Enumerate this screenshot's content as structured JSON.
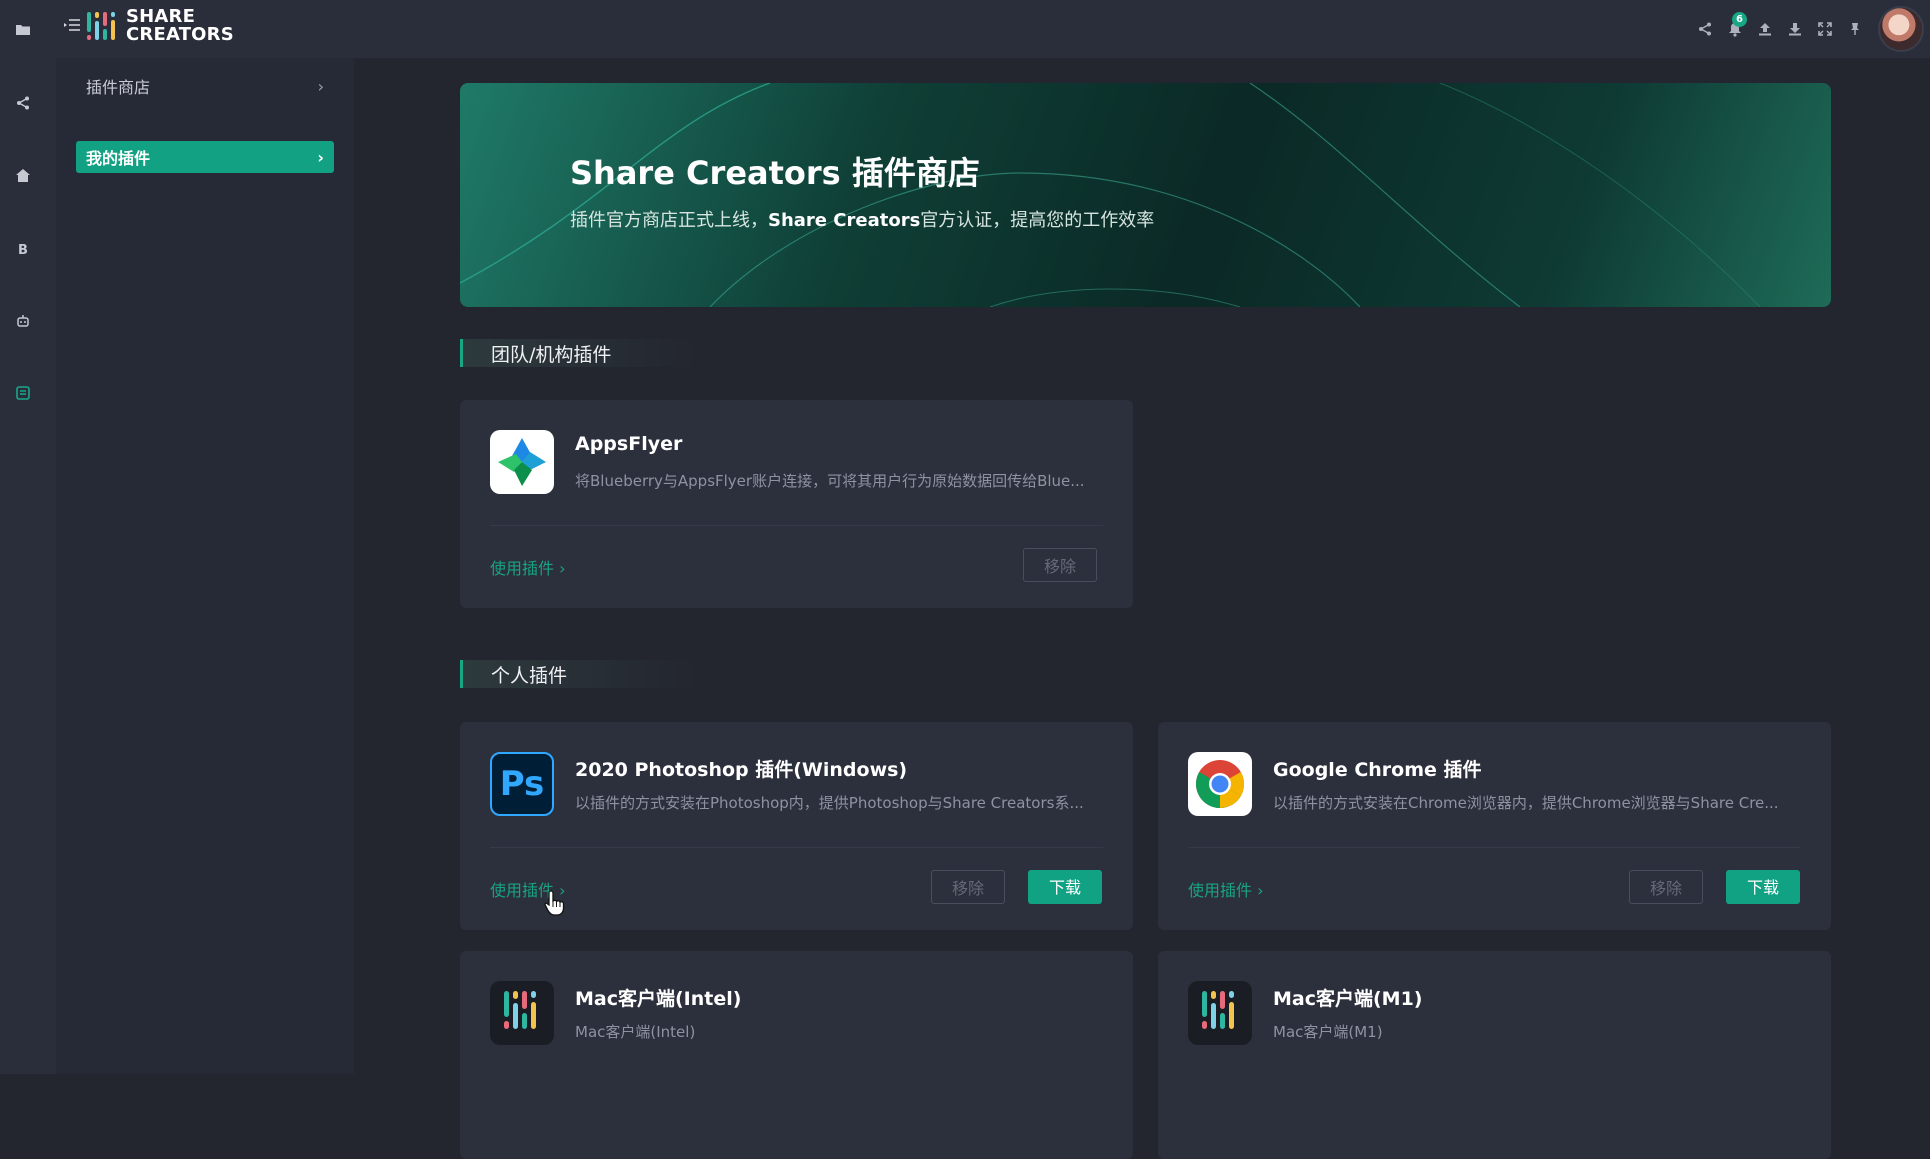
{
  "app": {
    "logo_line1": "SHARE",
    "logo_line2": "CREATORS",
    "notification_count": "6"
  },
  "sidebar": {
    "items": [
      {
        "label": "插件商店",
        "active": false
      },
      {
        "label": "我的插件",
        "active": true
      }
    ]
  },
  "hero": {
    "title": "Share Creators 插件商店",
    "subtitle_pre": "插件官方商店正式上线，",
    "subtitle_bold": "Share Creators",
    "subtitle_post": "官方认证，提高您的工作效率"
  },
  "sections": {
    "team": {
      "title": "团队/机构插件"
    },
    "personal": {
      "title": "个人插件"
    }
  },
  "cards": {
    "appsflyer": {
      "title": "AppsFlyer",
      "desc": "将Blueberry与AppsFlyer账户连接，可将其用户行为原始数据回传给Blue...",
      "link": "使用插件 ›",
      "remove": "移除"
    },
    "photoshop": {
      "title": "2020 Photoshop 插件(Windows)",
      "desc": "以插件的方式安装在Photoshop内，提供Photoshop与Share Creators系...",
      "link": "使用插件 ›",
      "remove": "移除",
      "download": "下载",
      "icon_text": "Ps"
    },
    "chrome": {
      "title": "Google Chrome 插件",
      "desc": "以插件的方式安装在Chrome浏览器内，提供Chrome浏览器与Share Cre...",
      "link": "使用插件 ›",
      "remove": "移除",
      "download": "下载"
    },
    "mac_intel": {
      "title": "Mac客户端(Intel)",
      "desc": "Mac客户端(Intel)"
    },
    "mac_m1": {
      "title": "Mac客户端(M1)",
      "desc": "Mac客户端(M1)"
    }
  },
  "icons": {
    "rail": [
      "folder-icon",
      "share-icon",
      "home-icon",
      "bitcoin-icon",
      "robot-icon",
      "plugin-store-icon"
    ],
    "top": [
      "share-icon",
      "bell-icon",
      "upload-icon",
      "download-icon",
      "fullscreen-icon",
      "pin-icon"
    ]
  },
  "colors": {
    "accent": "#12a183",
    "background": "#23252f",
    "card": "#2c2f3c",
    "sidebar": "#262936"
  }
}
